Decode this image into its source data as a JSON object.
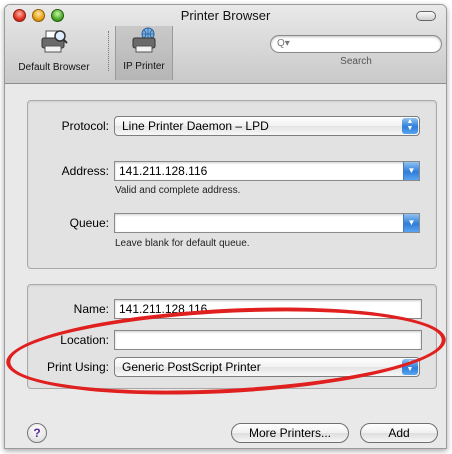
{
  "window": {
    "title": "Printer Browser"
  },
  "toolbar": {
    "default_browser_label": "Default Browser",
    "ip_printer_label": "IP Printer",
    "search_placeholder": "Q▾",
    "search_label": "Search"
  },
  "ip_group": {
    "protocol_label": "Protocol:",
    "protocol_value": "Line Printer Daemon – LPD",
    "address_label": "Address:",
    "address_value": "141.211.128.116",
    "address_hint": "Valid and complete address.",
    "queue_label": "Queue:",
    "queue_value": "",
    "queue_hint": "Leave blank for default queue."
  },
  "printer_group": {
    "name_label": "Name:",
    "name_value": "141.211.128.116",
    "location_label": "Location:",
    "location_value": "",
    "print_using_label": "Print Using:",
    "print_using_value": "Generic PostScript Printer"
  },
  "footer": {
    "help_label": "?",
    "more_printers_label": "More Printers...",
    "add_label": "Add"
  },
  "colors": {
    "annotation": "#e0201f",
    "popup_accent": "#2e7dd9"
  }
}
